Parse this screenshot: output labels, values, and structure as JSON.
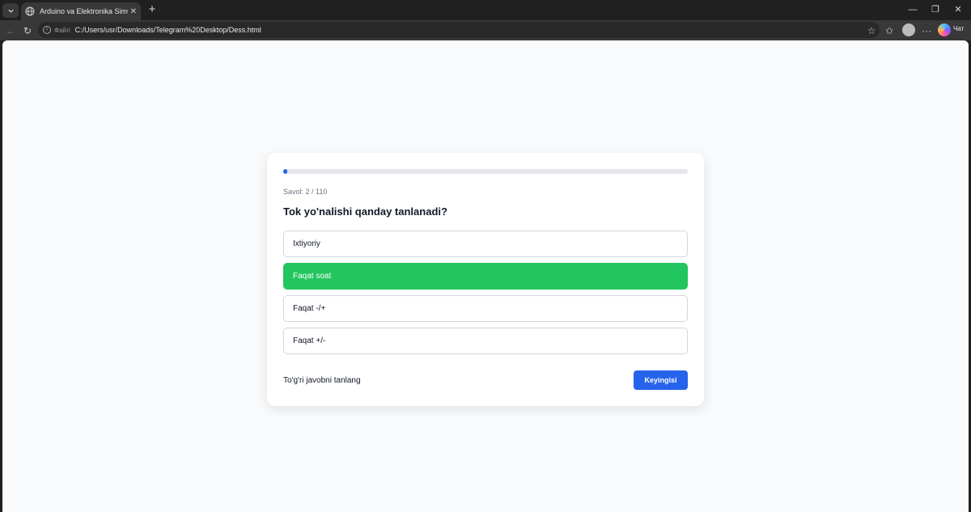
{
  "browser": {
    "tab_title": "Arduino va Elektronika Simulyatori",
    "file_label": "Файл",
    "url": "C:/Users/usr/Downloads/Telegram%20Desktop/Dess.html",
    "chat_label": "Чат"
  },
  "quiz": {
    "progress_fraction": 0.01,
    "counter": "Savol: 2 / 110",
    "question": "Tok yo'nalishi qanday tanlanadi?",
    "options": [
      {
        "label": "Ixtiyoriy",
        "state": "default"
      },
      {
        "label": "Faqat soat",
        "state": "correct"
      },
      {
        "label": "Faqat -/+",
        "state": "default"
      },
      {
        "label": "Faqat +/-",
        "state": "default"
      }
    ],
    "hint": "To'g'ri javobni tanlang",
    "next_label": "Keyingisi"
  },
  "colors": {
    "accent": "#2563eb",
    "correct": "#22c55e",
    "page_bg": "#f8fafc"
  }
}
